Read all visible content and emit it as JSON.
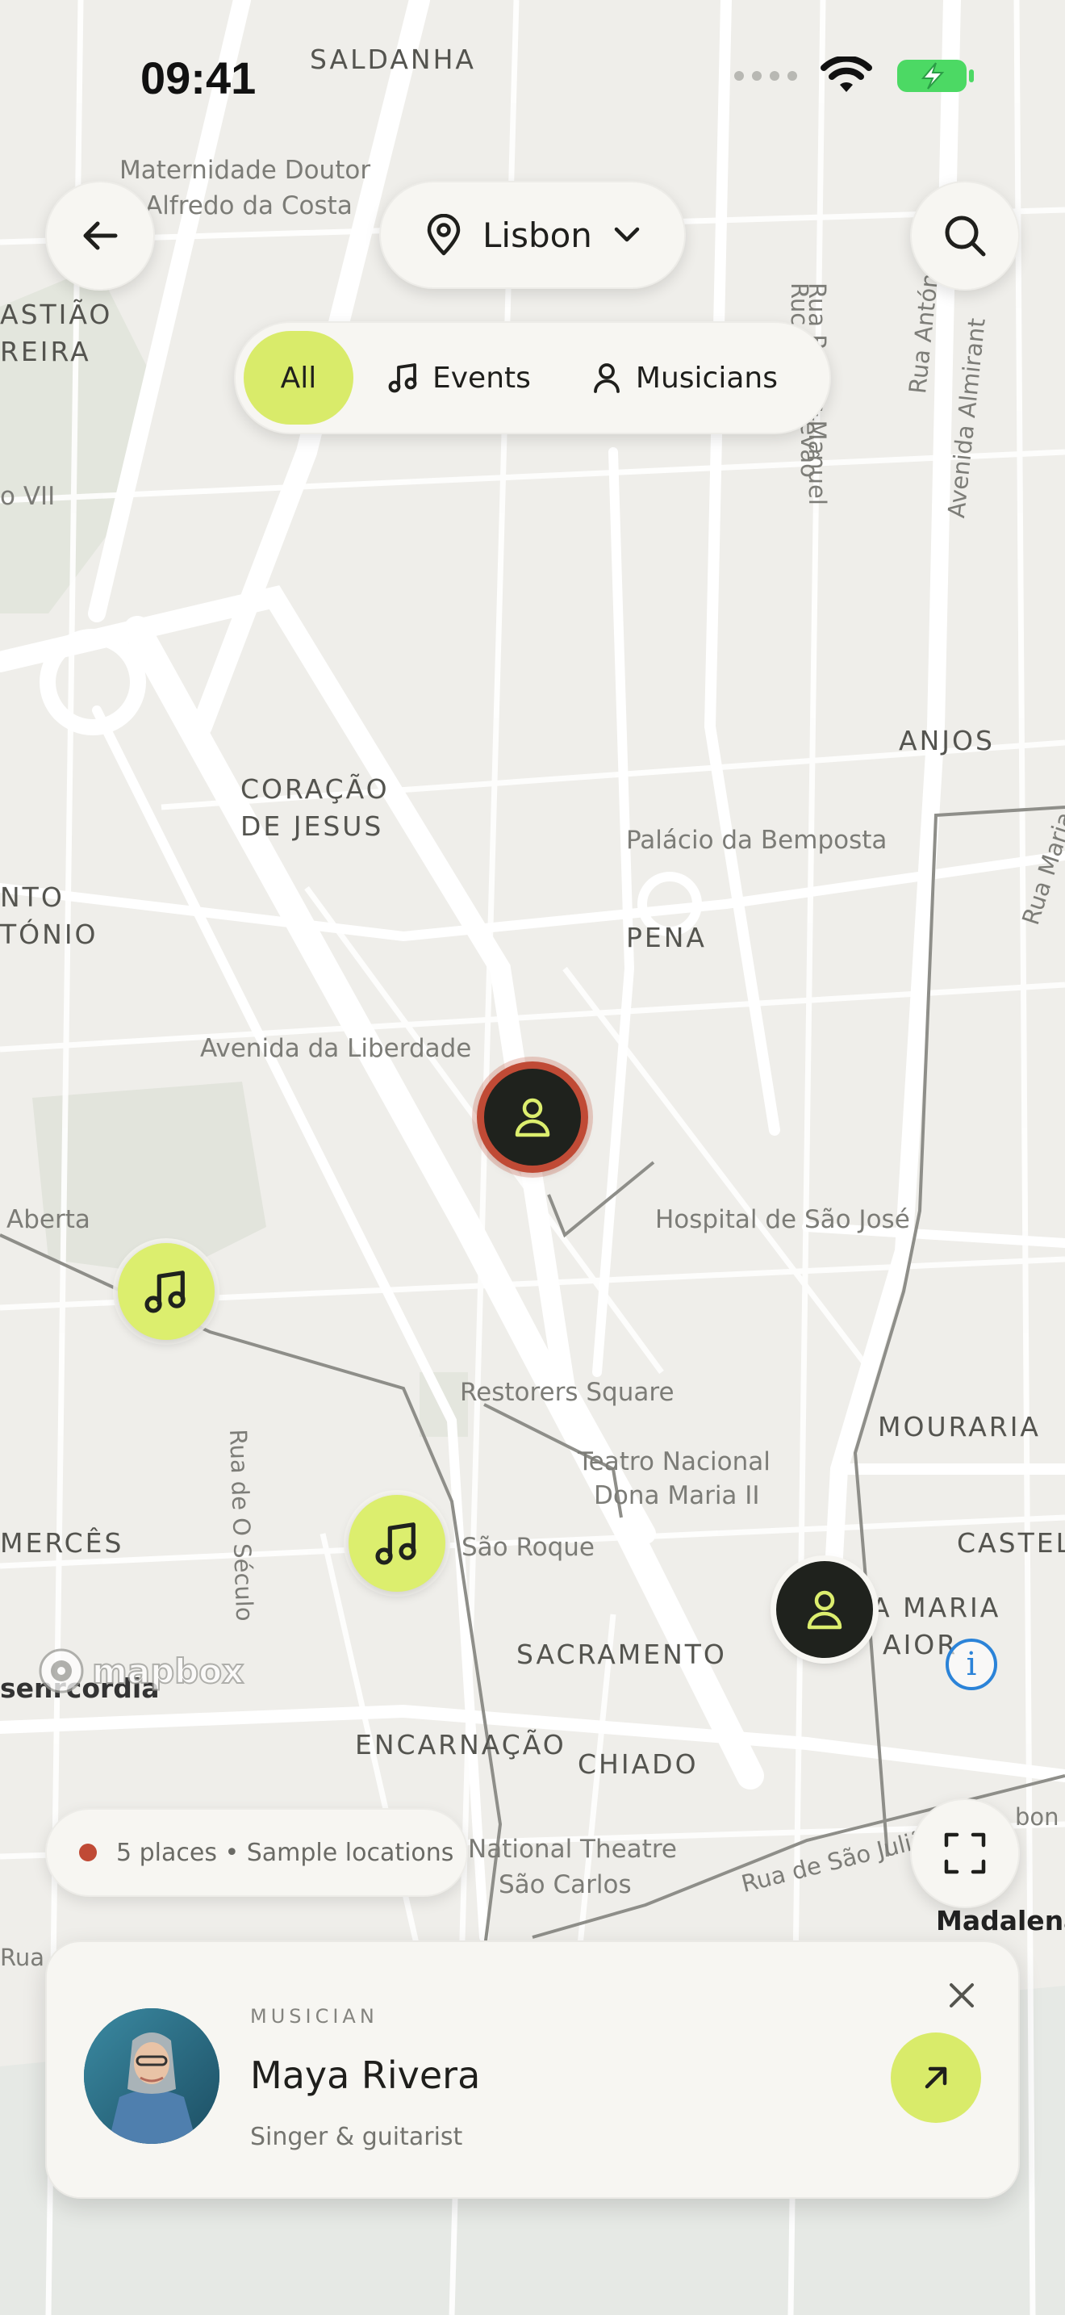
{
  "status_bar": {
    "time": "09:41"
  },
  "header": {
    "location": "Lisbon",
    "icons": {
      "back": "back-arrow-icon",
      "pin": "map-pin-icon",
      "chevron": "chevron-down-icon",
      "search": "search-icon"
    }
  },
  "filters": {
    "items": [
      {
        "label": "All",
        "selected": true
      },
      {
        "label": "Events",
        "icon": "music-note-icon"
      },
      {
        "label": "Musicians",
        "icon": "person-icon"
      }
    ],
    "accent_color": "#d9eb6a"
  },
  "map": {
    "area_labels": [
      "SALDANHA",
      "ASTIÃO",
      "REIRA",
      "ANJOS",
      "CORAÇÃO",
      "DE JESUS",
      "PENA",
      "NTO",
      "TÓNIO",
      "MOURARIA",
      "MERCÊS",
      "CASTEL",
      "A MARIA",
      "AIOR",
      "SACRAMENTO",
      "ENCARNAÇÃO",
      "CHIADO",
      "senrcordia",
      "Madalena"
    ],
    "poi_labels": [
      "Maternidade Doutor",
      "Alfredo da Costa",
      "Palácio da Bemposta",
      "Avenida da Liberdade",
      "Hospital de São José",
      "Restorers Square",
      "Teatro Nacional",
      "Dona Maria II",
      "São Roque",
      "National Theatre",
      "São Carlos",
      "o VII",
      "Aberta"
    ],
    "street_labels": [
      "Rua Passos Manuel",
      "Avenida Almirant",
      "Rua Antón",
      "Rua de O Século",
      "Rua de São Julião",
      "Rua Maria",
      "Rua",
      "tevão",
      "Ruc",
      "bon"
    ],
    "attribution": "mapbox",
    "markers": [
      {
        "type": "musician",
        "icon": "person-icon",
        "selected": true
      },
      {
        "type": "event",
        "icon": "music-note-icon"
      },
      {
        "type": "event",
        "icon": "music-note-icon"
      },
      {
        "type": "musician",
        "icon": "person-icon"
      }
    ],
    "marker_colors": {
      "event": "#dcee6e",
      "musician": "#1f221d",
      "selected_ring": "#c04a35"
    }
  },
  "places": {
    "summary": "5 places • Sample locations"
  },
  "detail_card": {
    "kicker": "MUSICIAN",
    "name": "Maya Rivera",
    "role": "Singer & guitarist",
    "icons": {
      "close": "close-icon",
      "open": "arrow-up-right-icon"
    }
  },
  "controls": {
    "fullscreen": "fullscreen-icon",
    "info": "info-icon"
  }
}
